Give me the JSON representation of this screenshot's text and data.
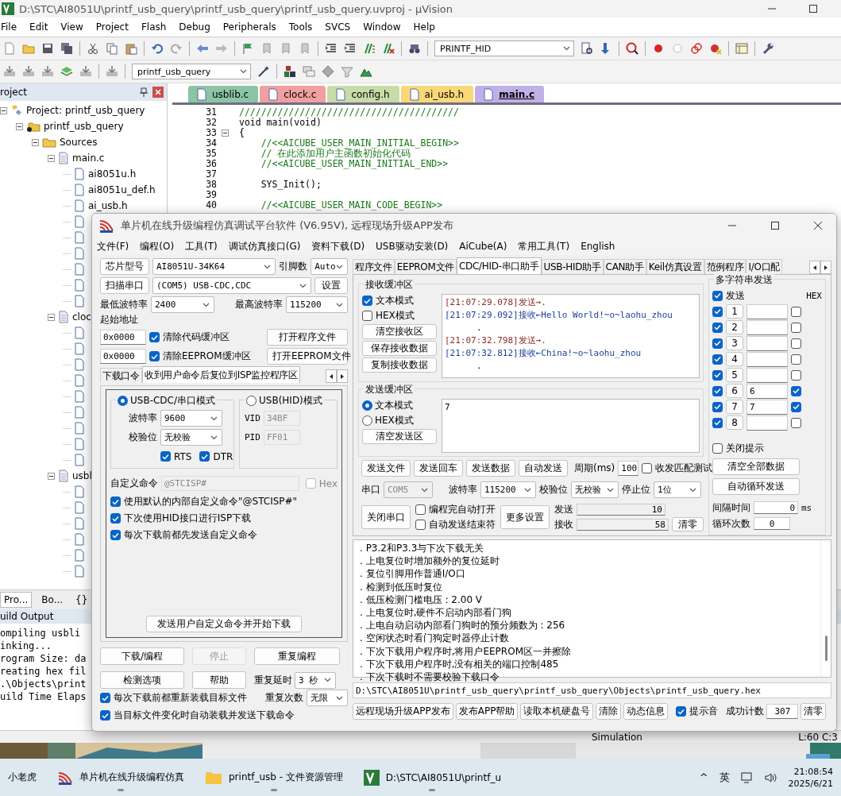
{
  "ide": {
    "title": "D:\\STC\\AI8051U\\printf_usb_query\\printf_usb_query\\printf_usb_query.uvproj - µVision",
    "menu": [
      "File",
      "Edit",
      "View",
      "Project",
      "Flash",
      "Debug",
      "Peripherals",
      "Tools",
      "SVCS",
      "Window",
      "Help"
    ],
    "target": "PRINTF_HID",
    "project_select": "printf_usb_query",
    "project_panel": {
      "title": "roject",
      "tree": [
        {
          "label": "Project: printf_usb_query",
          "kind": "project",
          "expanded": true,
          "children": [
            {
              "label": "printf_usb_query",
              "kind": "target",
              "expanded": true,
              "children": [
                {
                  "label": "Sources",
                  "kind": "folder",
                  "expanded": true,
                  "children": [
                    {
                      "label": "main.c",
                      "kind": "file",
                      "expanded": true,
                      "children": [
                        {
                          "label": "ai8051u.h",
                          "kind": "header"
                        },
                        {
                          "label": "ai8051u_def.h",
                          "kind": "header"
                        },
                        {
                          "label": "ai_usb.h",
                          "kind": "header"
                        },
                        {
                          "kind": "header"
                        },
                        {
                          "kind": "header"
                        },
                        {
                          "kind": "header"
                        },
                        {
                          "kind": "header"
                        },
                        {
                          "kind": "header"
                        },
                        {
                          "kind": "header"
                        }
                      ]
                    },
                    {
                      "label": "cloc",
                      "kind": "file",
                      "expanded": true,
                      "children": [
                        {
                          "kind": "header"
                        },
                        {
                          "kind": "header"
                        },
                        {
                          "kind": "header"
                        },
                        {
                          "kind": "header"
                        },
                        {
                          "kind": "header"
                        },
                        {
                          "kind": "header"
                        },
                        {
                          "kind": "header"
                        },
                        {
                          "kind": "header"
                        },
                        {
                          "kind": "header"
                        }
                      ]
                    },
                    {
                      "label": "usbl",
                      "kind": "file",
                      "expanded": true,
                      "children": [
                        {
                          "kind": "header"
                        },
                        {
                          "kind": "header"
                        },
                        {
                          "kind": "header"
                        },
                        {
                          "kind": "header"
                        },
                        {
                          "kind": "header"
                        },
                        {
                          "kind": "header"
                        }
                      ]
                    }
                  ]
                }
              ]
            }
          ]
        }
      ]
    },
    "panel_tabs": [
      {
        "label": "Pro...",
        "selected": true
      },
      {
        "label": "Bo...",
        "selected": false
      },
      {
        "label": "{}",
        "selected": false
      }
    ],
    "editor_tabs": [
      {
        "label": "usblib.c",
        "color": "#8cc4a6",
        "selected": false
      },
      {
        "label": "clock.c",
        "color": "#f0a0a0",
        "selected": false
      },
      {
        "label": "config.h",
        "color": "#c8dca8",
        "selected": false
      },
      {
        "label": "ai_usb.h",
        "color": "#f8d878",
        "selected": false
      },
      {
        "label": "main.c",
        "color": "#c0b0e8",
        "selected": true
      }
    ],
    "code": [
      {
        "line": "31",
        "kind": "comment",
        "text": "////////////////////////////////////////"
      },
      {
        "line": "32",
        "kind": "normal",
        "text": "void main(void)"
      },
      {
        "line": "33",
        "kind": "normal",
        "text": "{",
        "fold": true
      },
      {
        "line": "34",
        "kind": "comment",
        "text": "    //<<AICUBE_USER_MAIN_INITIAL_BEGIN>>"
      },
      {
        "line": "35",
        "kind": "comment",
        "text": "    // 在此添加用户主函数初始化代码"
      },
      {
        "line": "36",
        "kind": "comment",
        "text": "    //<<AICUBE_USER_MAIN_INITIAL_END>>"
      },
      {
        "line": "37"
      },
      {
        "line": "38",
        "kind": "normal",
        "text": "    SYS_Init();"
      },
      {
        "line": "39"
      },
      {
        "line": "40",
        "kind": "comment",
        "text": "    //<<AICUBE_USER_MAIN_CODE_BEGIN>>"
      }
    ],
    "build_output": {
      "title": "uild Output",
      "lines": [
        "ompiling usbli",
        "inking...",
        "rogram Size: da",
        "reating hex fil",
        ".\\Objects\\print",
        "uild Time Elaps"
      ]
    },
    "status": [
      "Simulation",
      "L:60 C:3"
    ]
  },
  "stc": {
    "title": "单片机在线升级编程仿真调试平台软件 (V6.95V), 远程现场升级APP发布",
    "menu": [
      "文件(F)",
      "编程(O)",
      "工具(T)",
      "调试仿真接口(G)",
      "资料下载(D)",
      "USB驱动安装(D)",
      "AiCube(A)",
      "常用工具(T)",
      "English"
    ],
    "chip_button": "芯片型号",
    "chip": "AI8051U-34K64",
    "pins_label": "引脚数",
    "pins": "Auto",
    "scan_button": "扫描串口",
    "port": "(COM5) USB-CDC,CDC",
    "settings_button": "设置",
    "min_baud_label": "最低波特率",
    "min_baud": "2400",
    "max_baud_label": "最高波特率",
    "max_baud": "115200",
    "start_address_label": "起始地址",
    "address_rows": [
      {
        "address": "0x0000",
        "label": "清除代码缓冲区",
        "checked": true,
        "button": "打开程序文件"
      },
      {
        "address": "0x0000",
        "label": "清除EEPROM缓冲区",
        "checked": true,
        "button": "打开EEPROM文件"
      }
    ],
    "left_tabs": [
      {
        "label": "下载口令",
        "selected": false
      },
      {
        "label": "收到用户命令后复位到ISP监控程序区",
        "selected": true
      }
    ],
    "isp": {
      "cdc_mode": {
        "label": "USB-CDC/串口模式",
        "selected": true
      },
      "baud_label": "波特率",
      "baud": "9600",
      "parity_label": "校验位",
      "parity": "无校验",
      "rts": {
        "label": "RTS",
        "checked": true
      },
      "dtr": {
        "label": "DTR",
        "checked": true
      },
      "hid_mode": {
        "label": "USB(HID)模式",
        "selected": false
      },
      "vid_label": "VID",
      "vid": "34BF",
      "pid_label": "PID",
      "pid": "FF01",
      "custom_label": "自定义命令",
      "custom": "@STCISP#",
      "hex": {
        "label": "Hex",
        "checked": false
      },
      "options": [
        {
          "label": "使用默认的内部自定义命令\"@STCISP#\"",
          "checked": true
        },
        {
          "label": "下次使用HID接口进行ISP下载",
          "checked": true
        },
        {
          "label": "每次下载前都先发送自定义命令",
          "checked": true
        }
      ],
      "send_button": "发送用户自定义命令并开始下载"
    },
    "actions": [
      {
        "label": "下载/编程",
        "disabled": false
      },
      {
        "label": "停止",
        "disabled": true
      },
      {
        "label": "重复编程",
        "disabled": false
      },
      {
        "label": "检测选项",
        "disabled": false
      },
      {
        "label": "帮助",
        "disabled": false
      }
    ],
    "repeat_delay_label": "重复延时",
    "repeat_delay": "3 秒",
    "repeat_count_label": "重复次数",
    "repeat_count": "无限",
    "reload_options": [
      {
        "label": "每次下载前都重新装载目标文件",
        "checked": true
      },
      {
        "label": "当目标文件变化时自动装载并发送下载命令",
        "checked": true
      }
    ],
    "right_tabs": [
      {
        "label": "程序文件",
        "selected": false
      },
      {
        "label": "EEPROM文件",
        "selected": false
      },
      {
        "label": "CDC/HID-串口助手",
        "selected": true
      },
      {
        "label": "USB-HID助手",
        "selected": false
      },
      {
        "label": "CAN助手",
        "selected": false
      },
      {
        "label": "Keil仿真设置",
        "selected": false
      },
      {
        "label": "范例程序",
        "selected": false
      },
      {
        "label": "I/O口配",
        "selected": false
      }
    ],
    "serial": {
      "receive": {
        "title": "接收缓冲区",
        "modes": [
          {
            "label": "文本模式",
            "checked": true
          },
          {
            "label": "HEX模式",
            "checked": false
          }
        ],
        "buttons": [
          "清空接收区",
          "保存接收数据",
          "复制接收数据"
        ],
        "lines": [
          {
            "kind": "send",
            "text": "[21:07:29.078]发送→."
          },
          {
            "kind": "receive",
            "text": "[21:07:29.092]接收←Hello World!~o~laohu_zhou"
          },
          {
            "kind": "dot",
            "text": "."
          },
          {
            "kind": "send",
            "text": "[21:07:32.798]发送→."
          },
          {
            "kind": "receive",
            "text": "[21:07:32.812]接收←China!~o~laohu_zhou"
          },
          {
            "kind": "dot",
            "text": "."
          }
        ]
      },
      "send": {
        "title": "发送缓冲区",
        "modes": [
          {
            "label": "文本模式",
            "selected": true
          },
          {
            "label": "HEX模式",
            "selected": false
          }
        ],
        "clear_button": "清空发送区",
        "value": "7"
      },
      "send_buttons": [
        "发送文件",
        "发送回车",
        "发送数据",
        "自动发送"
      ],
      "period_label": "周期(ms)",
      "period": "100",
      "match_test": {
        "label": "收发匹配测试",
        "checked": false
      },
      "port_label": "串口",
      "port": "COM5",
      "baud_label": "波特率",
      "baud": "115200",
      "parity_label": "校验位",
      "parity": "无校验",
      "stop_label": "停止位",
      "stop": "1位",
      "close_button": "关闭串口",
      "auto_open": {
        "label": "编程完自动打开",
        "checked": false
      },
      "auto_end": {
        "label": "自动发送结束符",
        "checked": false
      },
      "more_button": "更多设置",
      "sent_label": "发送",
      "sent": "10",
      "received_label": "接收",
      "received": "58",
      "reset_button": "清零"
    },
    "multi": {
      "title": "多字符串发送",
      "send_all": {
        "label": "发送",
        "checked": true
      },
      "hex_label": "HEX",
      "rows": [
        {
          "number": "1",
          "checked": true,
          "hex": false
        },
        {
          "number": "2",
          "checked": true,
          "hex": false
        },
        {
          "number": "3",
          "checked": true,
          "hex": false
        },
        {
          "number": "4",
          "checked": true,
          "hex": false
        },
        {
          "number": "5",
          "checked": true,
          "hex": false
        },
        {
          "number": "6",
          "checked": true,
          "value": "6",
          "hex": true
        },
        {
          "number": "7",
          "checked": true,
          "value": "7",
          "hex": true
        },
        {
          "number": "8",
          "checked": true,
          "hex": false
        }
      ],
      "close_tips": {
        "label": "关闭提示",
        "checked": false
      },
      "buttons": [
        "清空全部数据",
        "自动循环发送"
      ],
      "interval_label": "间隔时间",
      "interval": "0",
      "interval_unit": "ms",
      "loops_label": "循环次数",
      "loops": "0"
    },
    "log": [
      ". P3.2和P3.3与下次下载无关",
      ". 上电复位时增加额外的复位延时",
      ". 复位引脚用作普通I/O口",
      ". 检测到低压时复位",
      ". 低压检测门槛电压 : 2.00 V",
      ". 上电复位时,硬件不启动内部看门狗",
      ". 上电自动启动内部看门狗时的预分频数为 : 256",
      ". 空闲状态时看门狗定时器停止计数",
      ". 下次下载用户程序时,将用户EEPROM区一并擦除",
      ". 下次下载用户程序时,没有相关的端口控制485",
      ". 下次下载时不需要校验下载口令"
    ],
    "hex_path": "D:\\STC\\AI8051U\\printf_usb_query\\printf_usb_query\\Objects\\printf_usb_query.hex",
    "bottom_buttons": [
      "远程现场升级APP发布",
      "发布APP帮助",
      "读取本机硬盘号",
      "清除",
      "动态信息"
    ],
    "beep": {
      "label": "提示音",
      "checked": true
    },
    "count_label": "成功计数",
    "count": "307",
    "count_reset": "清零"
  },
  "taskbar": {
    "items": [
      {
        "label": "小老虎",
        "kind": "widget"
      },
      {
        "label": "单片机在线升级编程仿真",
        "kind": "stc"
      },
      {
        "label": "printf_usb - 文件资源管理",
        "kind": "folder"
      },
      {
        "label": "D:\\STC\\AI8051U\\printf_u",
        "kind": "uvision"
      }
    ],
    "tray_caret": "^",
    "ime": "英",
    "time": "21:08:54",
    "date": "2025/6/21"
  }
}
